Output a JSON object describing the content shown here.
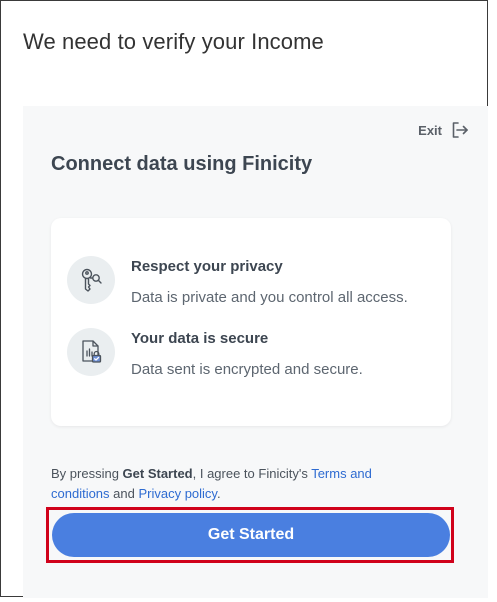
{
  "page": {
    "title": "We need to verify your Income"
  },
  "panel": {
    "exit_label": "Exit",
    "title": "Connect data using Finicity"
  },
  "features": [
    {
      "icon": "key-icon",
      "title": "Respect your privacy",
      "description": "Data is private and you control all access."
    },
    {
      "icon": "secure-document-icon",
      "title": "Your data is secure",
      "description": "Data sent is encrypted and secure."
    }
  ],
  "consent": {
    "prefix": "By pressing ",
    "bold": "Get Started",
    "middle": ", I agree to Finicity's ",
    "terms_link": "Terms and conditions",
    "and": " and ",
    "privacy_link": "Privacy policy",
    "suffix": "."
  },
  "cta": {
    "label": "Get Started"
  },
  "colors": {
    "accent": "#4a7fe0",
    "link": "#2e6bd1",
    "highlight_border": "#d0021b",
    "panel_bg": "#f7f8f9"
  }
}
